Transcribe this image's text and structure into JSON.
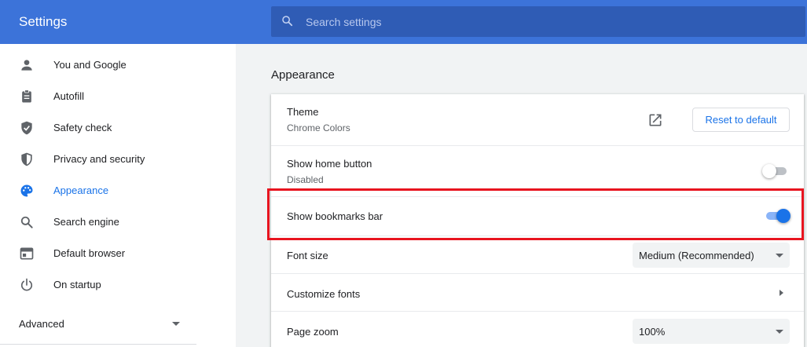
{
  "app": {
    "title": "Settings"
  },
  "search": {
    "placeholder": "Search settings"
  },
  "sidebar": {
    "items": [
      {
        "label": "You and Google",
        "icon": "person-icon"
      },
      {
        "label": "Autofill",
        "icon": "clipboard-icon"
      },
      {
        "label": "Safety check",
        "icon": "shield-check-icon"
      },
      {
        "label": "Privacy and security",
        "icon": "shield-half-icon"
      },
      {
        "label": "Appearance",
        "icon": "palette-icon",
        "active": true
      },
      {
        "label": "Search engine",
        "icon": "search-icon"
      },
      {
        "label": "Default browser",
        "icon": "browser-icon"
      },
      {
        "label": "On startup",
        "icon": "power-icon"
      }
    ],
    "advanced_label": "Advanced"
  },
  "main": {
    "section_title": "Appearance",
    "theme": {
      "label": "Theme",
      "value": "Chrome Colors",
      "reset_label": "Reset to default"
    },
    "home_button": {
      "label": "Show home button",
      "status": "Disabled",
      "enabled": false
    },
    "bookmarks_bar": {
      "label": "Show bookmarks bar",
      "enabled": true
    },
    "font_size": {
      "label": "Font size",
      "value": "Medium (Recommended)"
    },
    "customize_fonts": {
      "label": "Customize fonts"
    },
    "page_zoom": {
      "label": "Page zoom",
      "value": "100%"
    }
  },
  "colors": {
    "header": "#3c73d9",
    "search_bg": "#2f5cb5",
    "accent": "#1a73e8",
    "highlight": "#e8141f"
  }
}
